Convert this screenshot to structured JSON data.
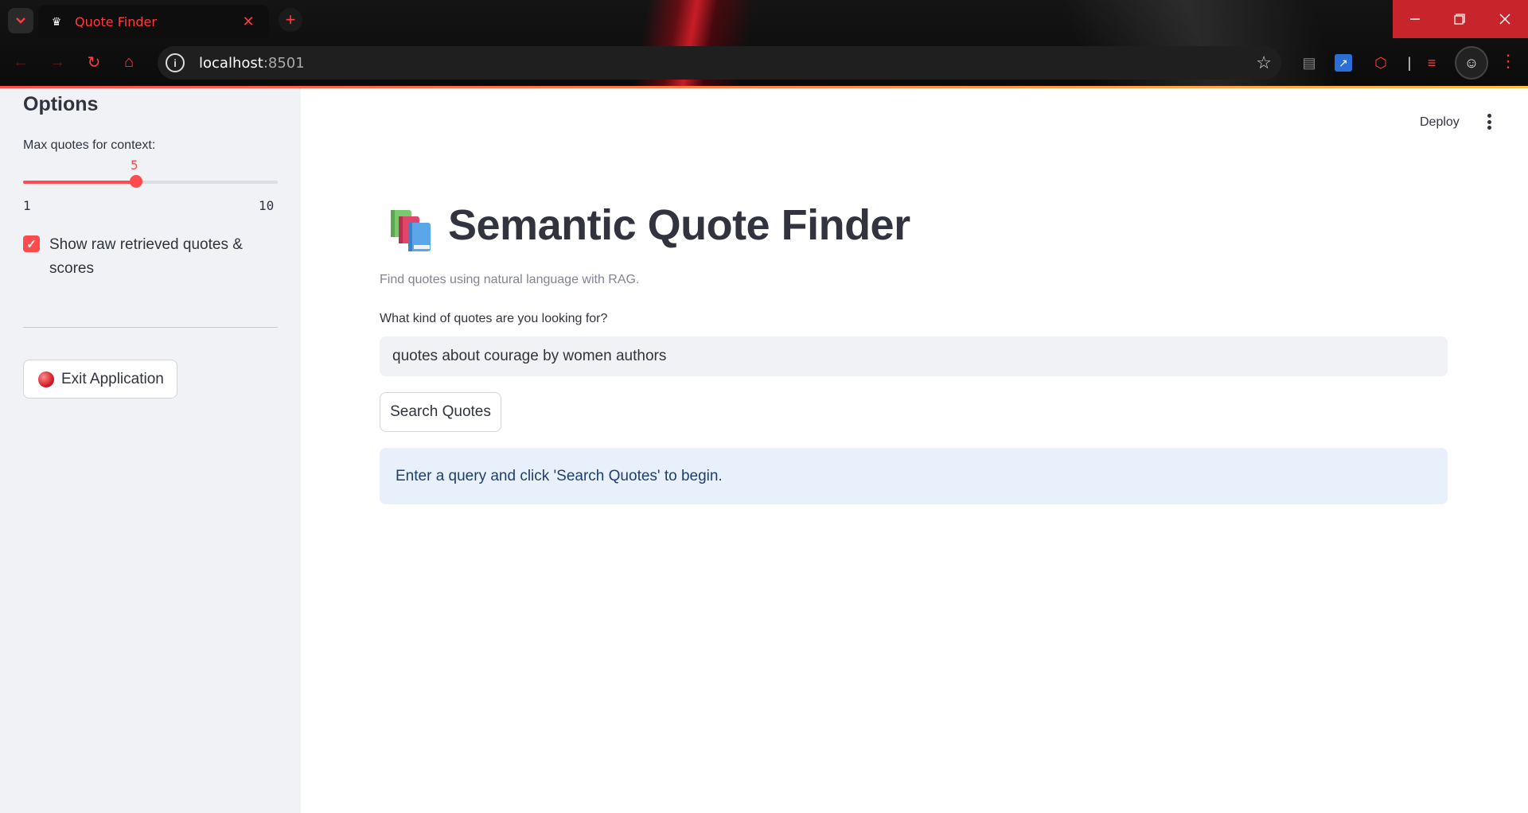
{
  "browser": {
    "tab_title": "Quote Finder",
    "url_host": "localhost",
    "url_port": ":8501",
    "colors": {
      "accent": "#ff3b3b",
      "window_controls": "#c8242b"
    }
  },
  "sidebar": {
    "title": "Options",
    "slider": {
      "label": "Max quotes for context:",
      "value": 5,
      "value_text": "5",
      "min": 1,
      "max": 10,
      "min_text": "1",
      "max_text": "10"
    },
    "checkbox": {
      "label": "Show raw retrieved quotes & scores",
      "checked": true
    },
    "exit_button": "Exit Application"
  },
  "header": {
    "deploy_label": "Deploy"
  },
  "main": {
    "title": "Semantic Quote Finder",
    "caption": "Find quotes using natural language with RAG.",
    "input_label": "What kind of quotes are you looking for?",
    "input_value": "quotes about courage by women authors",
    "search_button": "Search Quotes",
    "info_message": "Enter a query and click 'Search Quotes' to begin."
  },
  "colors": {
    "primary": "#ff4b4b",
    "text": "#31333f",
    "sidebar_bg": "#f0f2f6",
    "info_bg": "#e8f0fb"
  }
}
